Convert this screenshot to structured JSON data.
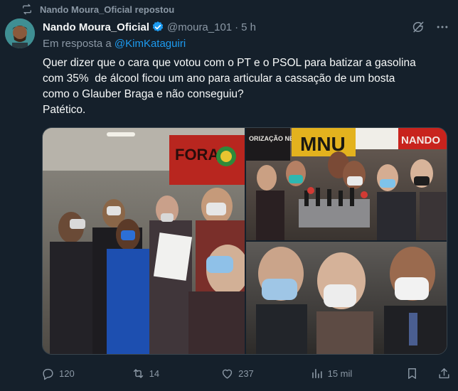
{
  "repost": {
    "text": "Nando Moura_Oficial repostou"
  },
  "author": {
    "display_name": "Nando Moura_Oficial",
    "handle": "@moura_101",
    "separator": "·",
    "time": "5 h"
  },
  "reply": {
    "prefix": "Em resposta a",
    "mention": "@KimKataguiri"
  },
  "tweet": {
    "text": "Quer dizer que o cara que votou com o PT e o PSOL para batizar a gasolina\ncom 35%  de álcool ficou um ano para articular a cassação de um bosta\ncomo o Glauber Braga e não conseguiu?\nPatético."
  },
  "media": {
    "photo1": {
      "sign_text": "FORA"
    },
    "photo2": {
      "banner_text": "MNU",
      "sign_text": "ORIZAÇÃO NEGRA",
      "right_text": "NANDO"
    }
  },
  "metrics": {
    "replies": "120",
    "reposts": "14",
    "likes": "237",
    "views": "15 mil"
  },
  "colors": {
    "background": "#15202b",
    "text_secondary": "#8b98a5",
    "accent": "#1d9bf0"
  }
}
